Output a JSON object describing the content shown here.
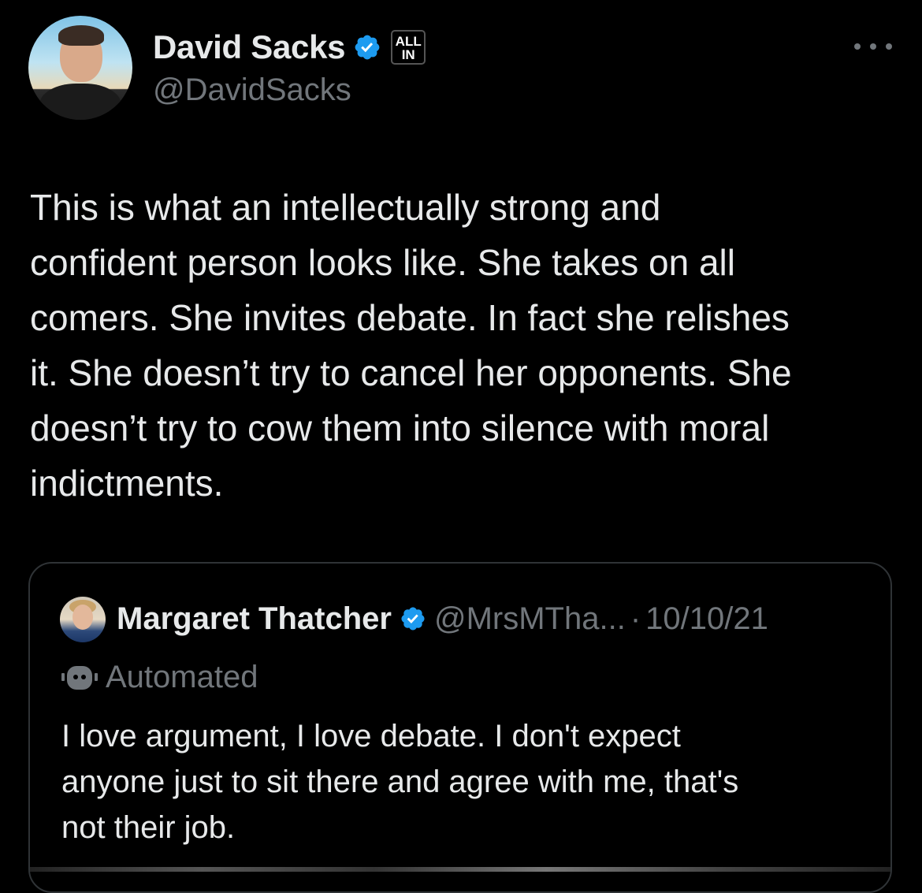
{
  "tweet": {
    "author_name": "David Sacks",
    "author_handle": "@DavidSacks",
    "affiliate_badge": "ALL\nIN",
    "text": "This is what an intellectually strong and\nconfident person looks like. She takes on all\ncomers. She invites debate. In fact she relishes\nit. She doesn’t try to cancel her opponents. She\ndoesn’t try to cow them into silence with moral\nindictments.",
    "more_icon": "more-horizontal-icon",
    "verified_icon": "verified-badge-icon"
  },
  "quote": {
    "author_name": "Margaret Thatcher",
    "author_handle": "@MrsMTha...",
    "separator": "·",
    "date": "10/10/21",
    "automated_label": "Automated",
    "automated_icon": "bot-icon",
    "text": "I love argument, I love debate. I don't expect\nanyone just to sit there and agree with me, that's\nnot their job."
  },
  "colors": {
    "background": "#000000",
    "text_primary": "#e7e9ea",
    "text_secondary": "#71767b",
    "verified_blue": "#1d9bf0",
    "border": "#2f3336"
  }
}
